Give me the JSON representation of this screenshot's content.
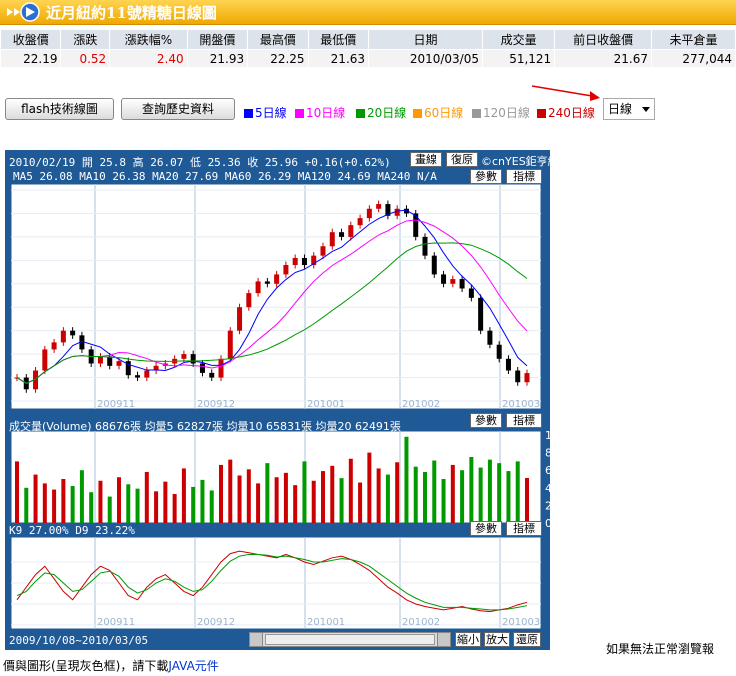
{
  "header": {
    "title": "近月紐約11號精糖日線圖",
    "logo_icon": "arrow-right-icon"
  },
  "quote_table": {
    "headers": [
      "收盤價",
      "漲跌",
      "漲跌幅%",
      "開盤價",
      "最高價",
      "最低價",
      "日期",
      "成交量",
      "前日收盤價",
      "未平倉量"
    ],
    "values": [
      "22.19",
      "0.52",
      "2.40",
      "21.93",
      "22.25",
      "21.63",
      "2010/03/05",
      "51,121",
      "21.67",
      "277,044"
    ],
    "up_color": "#e00000"
  },
  "toolbar": {
    "flash_label": "flash技術線圖",
    "history_label": "查詢歷史資料"
  },
  "ma_legend": [
    {
      "label": "5日線",
      "color": "#0000ff"
    },
    {
      "label": "10日線",
      "color": "#ff00ff"
    },
    {
      "label": "20日線",
      "color": "#009900"
    },
    {
      "label": "60日線",
      "color": "#ff9900"
    },
    {
      "label": "120日線",
      "color": "#999999"
    },
    {
      "label": "240日線",
      "color": "#cc0000"
    }
  ],
  "period_select": {
    "value": "日線"
  },
  "chart": {
    "info_line": "2010/02/19 開 25.8 高 26.07 低 25.36 收 25.96 +0.16(+0.62%)",
    "ma_line": "MA5 26.08   MA10 26.38   MA20 27.69   MA60 26.29   MA120 24.69   MA240 N/A",
    "draw_label": "畫線",
    "restore_label": "復原",
    "copyright": "©cnYES鉅亨網",
    "param_label": "參數",
    "indicator_label": "指標",
    "price_ticks": [
      "30",
      "29",
      "28",
      "27",
      "26",
      "25",
      "24",
      "23",
      "22",
      "21"
    ],
    "date_labels": [
      "200911",
      "200912",
      "201001",
      "201002",
      "201003"
    ],
    "volume_line": "成交量(Volume) 68676張  均量5 62827張  均量10 65831張  均量20 62491張",
    "volume_ticks": [
      "100000",
      "80000",
      "60000",
      "40000",
      "20000",
      "0"
    ],
    "kd_line": "K9 27.00%  D9 23.22%",
    "kd_ticks": [
      "75",
      "50",
      "25",
      "0"
    ],
    "range_label": "2009/10/08~2010/03/05",
    "zoom_out": "縮小",
    "zoom_in": "放大",
    "reset": "還原"
  },
  "chart_data": {
    "type": "candlestick",
    "x_range": [
      "2009/10/08",
      "2010/03/05"
    ],
    "price_ylim": [
      21,
      30
    ],
    "price_close": [
      22.0,
      21.5,
      22.3,
      23.2,
      23.5,
      24.0,
      23.8,
      23.2,
      22.6,
      22.9,
      22.5,
      22.7,
      22.1,
      22.0,
      22.3,
      22.5,
      22.6,
      22.8,
      23.0,
      22.6,
      22.2,
      22.0,
      22.8,
      24.0,
      25.0,
      25.6,
      26.1,
      26.0,
      26.4,
      26.8,
      27.1,
      26.8,
      27.2,
      27.6,
      28.2,
      28.0,
      28.5,
      28.8,
      29.2,
      29.4,
      28.9,
      29.2,
      29.0,
      28.0,
      27.2,
      26.4,
      26.0,
      26.2,
      25.8,
      25.4,
      24.0,
      23.4,
      22.8,
      22.3,
      21.8,
      22.19
    ],
    "volume_ylim": [
      0,
      100000
    ],
    "volume": [
      70000,
      40000,
      55000,
      45000,
      38000,
      50000,
      42000,
      60000,
      35000,
      48000,
      30000,
      52000,
      44000,
      39000,
      58000,
      36000,
      47000,
      33000,
      62000,
      41000,
      49000,
      37000,
      66000,
      72000,
      54000,
      61000,
      45000,
      68000,
      52000,
      57000,
      43000,
      70000,
      48000,
      59000,
      65000,
      51000,
      73000,
      46000,
      80000,
      62000,
      55000,
      69000,
      98000,
      64000,
      58000,
      71000,
      50000,
      66000,
      60000,
      75000,
      63000,
      72000,
      68000,
      59000,
      70000,
      51121
    ],
    "kd_ylim": [
      0,
      100
    ],
    "k": [
      30,
      45,
      60,
      70,
      55,
      40,
      30,
      45,
      60,
      70,
      65,
      50,
      35,
      30,
      45,
      55,
      60,
      50,
      40,
      35,
      45,
      60,
      75,
      85,
      88,
      86,
      84,
      82,
      80,
      84,
      80,
      75,
      72,
      76,
      80,
      82,
      78,
      72,
      65,
      55,
      45,
      38,
      30,
      25,
      22,
      20,
      18,
      20,
      22,
      19,
      17,
      16,
      18,
      20,
      24,
      27
    ],
    "d": [
      35,
      40,
      52,
      62,
      60,
      50,
      40,
      42,
      52,
      62,
      64,
      58,
      45,
      38,
      42,
      50,
      55,
      52,
      45,
      40,
      42,
      52,
      65,
      76,
      82,
      84,
      84,
      83,
      81,
      82,
      80,
      78,
      75,
      75,
      77,
      79,
      78,
      75,
      70,
      62,
      54,
      46,
      38,
      32,
      27,
      24,
      21,
      21,
      21,
      20,
      19,
      18,
      18,
      19,
      21,
      23
    ]
  },
  "footer": {
    "text1": "如果無法正常瀏覽報",
    "text2": "價與圖形(呈現灰色框)，請下載",
    "java_link": "JAVA元件"
  }
}
